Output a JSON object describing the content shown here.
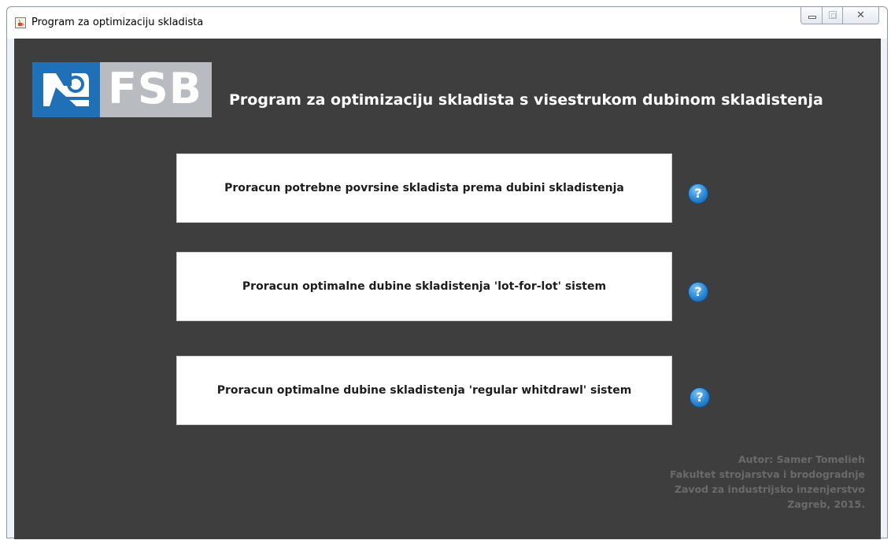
{
  "window": {
    "title": "Program za optimizaciju skladista",
    "icon": "java-cup-icon",
    "controls": [
      "minimize",
      "maximize",
      "close"
    ]
  },
  "logo": {
    "text": "FSB",
    "colors": {
      "blue": "#1f70b6",
      "grey": "#b8bcc0"
    }
  },
  "main": {
    "heading": "Program za optimizaciju skladista s visestrukom dubinom skladistenja",
    "buttons": [
      {
        "label": "Proracun potrebne povrsine skladista prema dubini skladistenja",
        "help": "?"
      },
      {
        "label": "Proracun optimalne dubine skladistenja 'lot-for-lot' sistem",
        "help": "?"
      },
      {
        "label": "Proracun optimalne dubine skladistenja 'regular whitdrawl' sistem",
        "help": "?"
      }
    ]
  },
  "credits": {
    "lines": [
      "Autor: Samer Tomelieh",
      "Fakultet strojarstva i brodogradnje",
      "Zavod za industrijsko inzenjerstvo",
      "Zagreb, 2015."
    ]
  },
  "colors": {
    "background": "#3e3e3e",
    "help_icon": "#2a86d3",
    "credits_text": "#6a6a6a"
  }
}
